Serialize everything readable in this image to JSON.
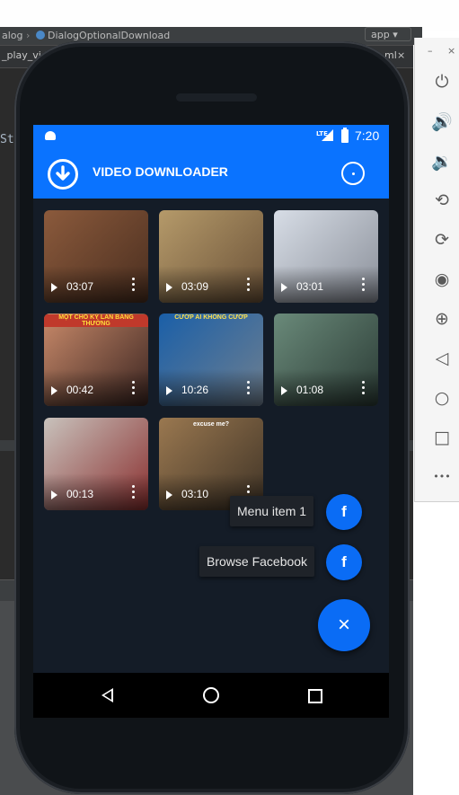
{
  "ide": {
    "tab_dialog": "alog",
    "tab_separator": "›",
    "tab_dialog_download": "DialogOptionalDownload",
    "run_config": "app",
    "file_left": "_play_vid",
    "file_right": "ml",
    "file_close": "×",
    "editor_fragment": "St"
  },
  "emulator": {
    "minimize_label": "–",
    "close_label": "×",
    "buttons": [
      {
        "name": "power-icon",
        "glyph": "⏻"
      },
      {
        "name": "volume-up-icon",
        "glyph": "🔊"
      },
      {
        "name": "volume-down-icon",
        "glyph": "🔉"
      },
      {
        "name": "rotate-left-icon",
        "glyph": "⟲"
      },
      {
        "name": "rotate-right-icon",
        "glyph": "⟳"
      },
      {
        "name": "camera-icon",
        "glyph": "◉"
      },
      {
        "name": "zoom-icon",
        "glyph": "⊕"
      },
      {
        "name": "back-icon",
        "glyph": "◁"
      },
      {
        "name": "home-icon",
        "glyph": "○"
      },
      {
        "name": "overview-icon",
        "glyph": "□"
      },
      {
        "name": "more-icon",
        "glyph": "•••"
      }
    ]
  },
  "status_bar": {
    "network": "LTE",
    "time": "7:20"
  },
  "app_bar": {
    "title": "VIDEO DOWNLOADER"
  },
  "videos": [
    {
      "duration": "03:07",
      "caption": "",
      "colors": [
        "#8b5a3c",
        "#4a2e1f"
      ]
    },
    {
      "duration": "03:09",
      "caption": "",
      "colors": [
        "#b59a6a",
        "#6b5238"
      ]
    },
    {
      "duration": "03:01",
      "caption": "",
      "colors": [
        "#d7dde6",
        "#8a8f99"
      ]
    },
    {
      "duration": "00:42",
      "caption": "MỘT CHÓ KỲ LAN BÁNG THƯỜNG",
      "colors": [
        "#c98a6a",
        "#3a2420"
      ]
    },
    {
      "duration": "10:26",
      "caption": "CƯỚP AI KHÔNG CƯỚP",
      "colors": [
        "#1a5fa8",
        "#6f7f8f"
      ]
    },
    {
      "duration": "01:08",
      "caption": "",
      "colors": [
        "#6a8a7a",
        "#2a3a34"
      ]
    },
    {
      "duration": "00:13",
      "caption": "",
      "colors": [
        "#c8c2bc",
        "#8a2f2f"
      ]
    },
    {
      "duration": "03:10",
      "caption": "excuse me?",
      "colors": [
        "#9a7850",
        "#3f3326"
      ]
    }
  ],
  "fab_menu": {
    "items": [
      {
        "label": "Menu item 1",
        "icon": "f"
      },
      {
        "label": "Browse Facebook",
        "icon": "f"
      }
    ],
    "close_icon": "×"
  },
  "colors": {
    "accent": "#0a73ff",
    "fab": "#0a6cf5",
    "content_bg": "#141c27"
  }
}
